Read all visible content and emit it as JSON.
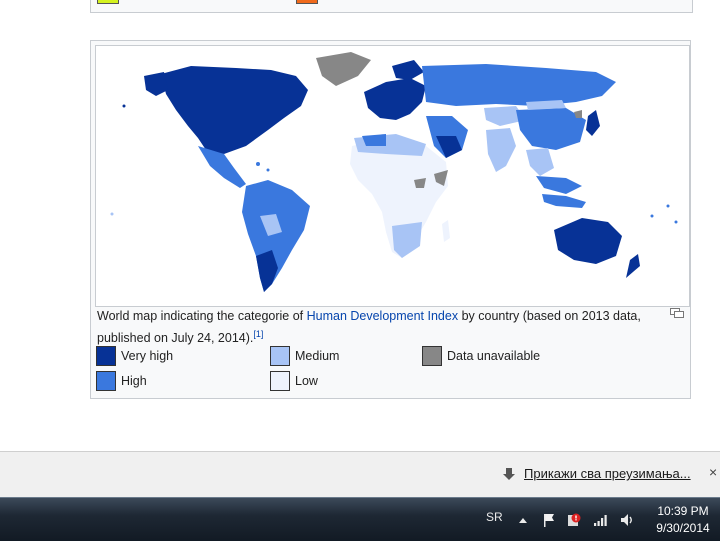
{
  "figure": {
    "caption_prefix": "World map indicating the categorie of ",
    "caption_link": "Human Development Index",
    "caption_suffix": " by country (based on 2013 data, published on July 24, 2014).",
    "caption_ref": "[1]",
    "legend": [
      {
        "label": "Very high",
        "color": "#073296"
      },
      {
        "label": "High",
        "color": "#3a78de"
      },
      {
        "label": "Medium",
        "color": "#a8c4f5"
      },
      {
        "label": "Low",
        "color": "#eef3fd"
      },
      {
        "label": "Data unavailable",
        "color": "#878787"
      }
    ]
  },
  "download_bar": {
    "show_all_label": "Прикажи сва преузимања...",
    "close_label": "×"
  },
  "taskbar": {
    "language": "SR",
    "time": "10:39 PM",
    "date": "9/30/2014"
  }
}
